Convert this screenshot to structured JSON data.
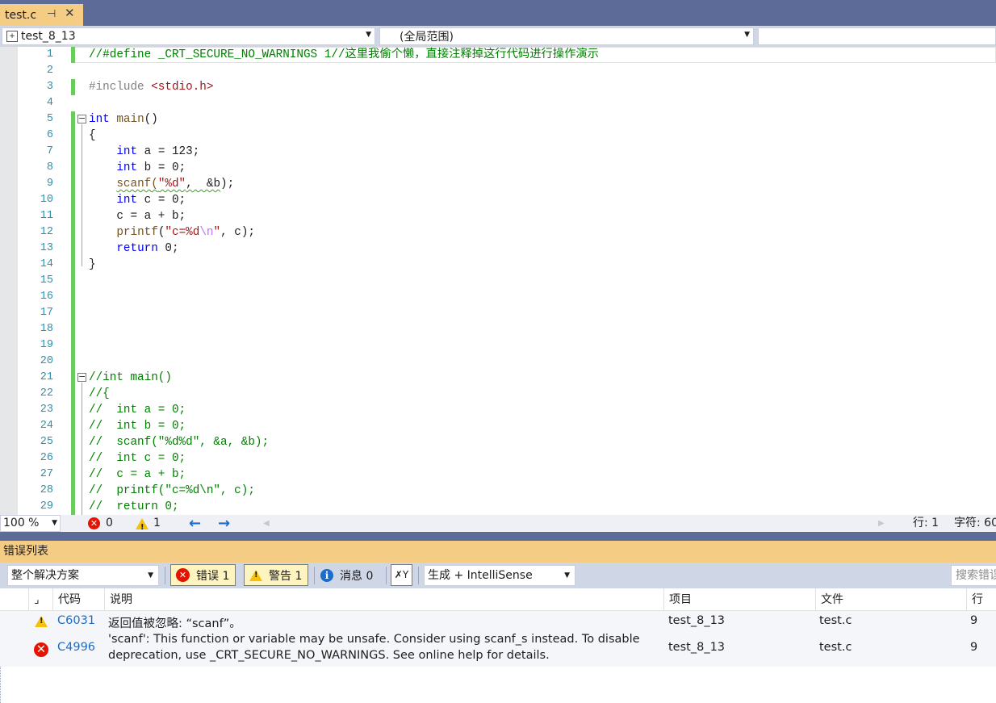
{
  "tab": {
    "title": "test.c",
    "pin": "⊣",
    "close": "✕"
  },
  "navbar": {
    "project": "test_8_13",
    "scope": "(全局范围)"
  },
  "editor": {
    "line_numbers": [
      "1",
      "2",
      "3",
      "4",
      "5",
      "6",
      "7",
      "8",
      "9",
      "10",
      "11",
      "12",
      "13",
      "14",
      "15",
      "16",
      "17",
      "18",
      "19",
      "20",
      "21",
      "22",
      "23",
      "24",
      "25",
      "26",
      "27",
      "28",
      "29"
    ],
    "lines": [
      [
        {
          "t": "//#define _CRT_SECURE_NO_WARNINGS 1//这里我偷个懒，直接注释掉这行代码进行操作演示",
          "c": "cmt"
        }
      ],
      [],
      [
        {
          "t": "#include ",
          "c": "pp"
        },
        {
          "t": "<stdio.h>",
          "c": "str"
        }
      ],
      [],
      [
        {
          "t": "int",
          "c": "kw"
        },
        {
          "t": " "
        },
        {
          "t": "main",
          "c": "fn"
        },
        {
          "t": "()"
        }
      ],
      [
        {
          "t": "{"
        }
      ],
      [
        {
          "t": "    "
        },
        {
          "t": "int",
          "c": "kw"
        },
        {
          "t": " a = 123;"
        }
      ],
      [
        {
          "t": "    "
        },
        {
          "t": "int",
          "c": "kw"
        },
        {
          "t": " b = 0;"
        }
      ],
      [
        {
          "t": "    "
        },
        {
          "t": "scanf(",
          "c": "fn squig"
        },
        {
          "t": "\"%d\"",
          "c": "str squig"
        },
        {
          "t": ",  &b",
          "c": "squig"
        },
        {
          "t": ");"
        }
      ],
      [
        {
          "t": "    "
        },
        {
          "t": "int",
          "c": "kw"
        },
        {
          "t": " c = 0;"
        }
      ],
      [
        {
          "t": "    c = a + b;"
        }
      ],
      [
        {
          "t": "    "
        },
        {
          "t": "printf",
          "c": "fn"
        },
        {
          "t": "("
        },
        {
          "t": "\"c=%d",
          "c": "str"
        },
        {
          "t": "\\n",
          "c": "esc"
        },
        {
          "t": "\"",
          "c": "str"
        },
        {
          "t": ", c);"
        }
      ],
      [
        {
          "t": "    "
        },
        {
          "t": "return",
          "c": "kw"
        },
        {
          "t": " 0;"
        }
      ],
      [
        {
          "t": "}"
        }
      ],
      [],
      [],
      [],
      [],
      [],
      [],
      [
        {
          "t": "//int main()",
          "c": "cmt"
        }
      ],
      [
        {
          "t": "//{",
          "c": "cmt"
        }
      ],
      [
        {
          "t": "//  int a = 0;",
          "c": "cmt"
        }
      ],
      [
        {
          "t": "//  int b = 0;",
          "c": "cmt"
        }
      ],
      [
        {
          "t": "//  scanf(\"%d%d\", &a, &b);",
          "c": "cmt"
        }
      ],
      [
        {
          "t": "//  int c = 0;",
          "c": "cmt"
        }
      ],
      [
        {
          "t": "//  c = a + b;",
          "c": "cmt"
        }
      ],
      [
        {
          "t": "//  printf(\"c=%d\\n\", c);",
          "c": "cmt"
        }
      ],
      [
        {
          "t": "//  return 0;",
          "c": "cmt"
        }
      ]
    ]
  },
  "status": {
    "zoom": "100 %",
    "errors": "0",
    "warnings": "1",
    "line": "行: 1",
    "char": "字符: 60"
  },
  "error_list": {
    "title": "错误列表",
    "scope": "整个解决方案",
    "errors_btn": "错误 1",
    "warnings_btn": "警告 1",
    "messages_btn": "消息 0",
    "build_filter": "生成 + IntelliSense",
    "search_placeholder": "搜索错误列表",
    "columns": {
      "code": "代码",
      "description": "说明",
      "project": "项目",
      "file": "文件",
      "line": "行"
    },
    "rows": [
      {
        "severity": "warning",
        "code": "C6031",
        "description": "返回值被忽略: “scanf”。",
        "project": "test_8_13",
        "file": "test.c",
        "line": "9"
      },
      {
        "severity": "error",
        "code": "C4996",
        "description_1": "'scanf': This function or variable may be unsafe. Consider using scanf_s instead. To disable",
        "description_2": "deprecation, use _CRT_SECURE_NO_WARNINGS. See online help for details.",
        "project": "test_8_13",
        "file": "test.c",
        "line": "9"
      }
    ]
  }
}
